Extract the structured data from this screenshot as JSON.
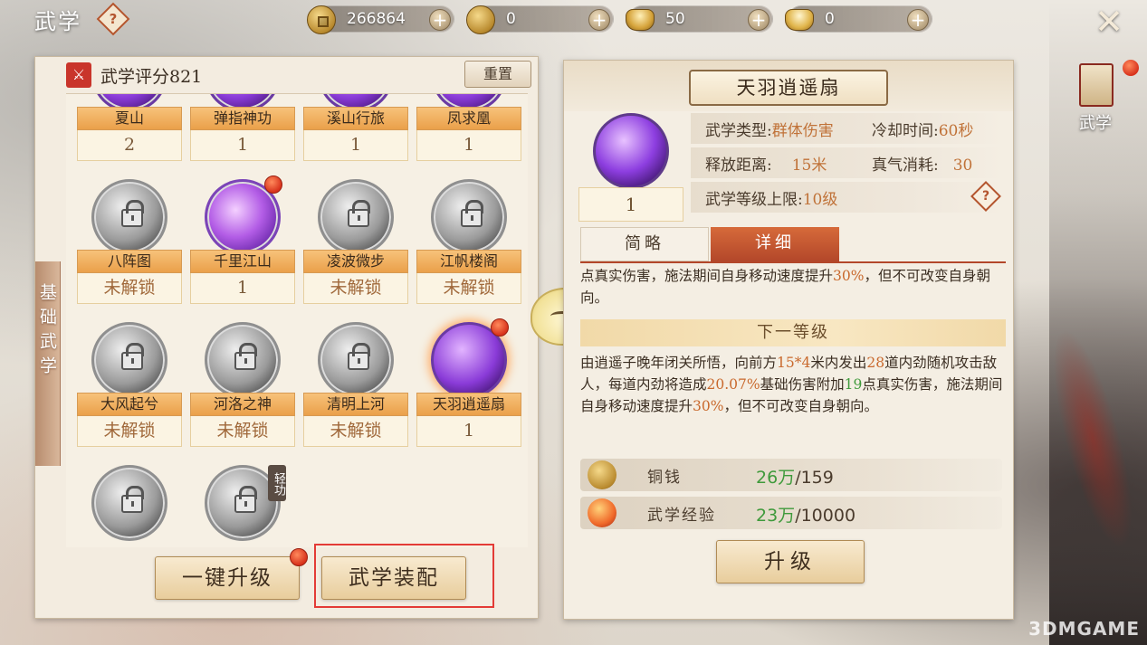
{
  "header": {
    "title": "武学",
    "help_symbol": "?",
    "close_symbol": "✕"
  },
  "currencies": [
    {
      "icon": "copper-coin-icon",
      "value": "266864",
      "plus": "+"
    },
    {
      "icon": "gold-coin-icon",
      "value": "0",
      "plus": "+"
    },
    {
      "icon": "gold-ingot-icon",
      "value": "50",
      "plus": "+"
    },
    {
      "icon": "silver-ingot-icon",
      "value": "0",
      "plus": "+"
    }
  ],
  "left_panel": {
    "side_tab": "基础武学",
    "score_label": "武学评分821",
    "reset_label": "重置",
    "skills": [
      {
        "name": "夏山",
        "value": "2",
        "locked": false
      },
      {
        "name": "弹指神功",
        "value": "1",
        "locked": false
      },
      {
        "name": "溪山行旅",
        "value": "1",
        "locked": false
      },
      {
        "name": "凤求凰",
        "value": "1",
        "locked": false
      },
      {
        "name": "八阵图",
        "value": "未解锁",
        "locked": true
      },
      {
        "name": "千里江山",
        "value": "1",
        "locked": false
      },
      {
        "name": "凌波微步",
        "value": "未解锁",
        "locked": true
      },
      {
        "name": "江帆楼阁",
        "value": "未解锁",
        "locked": true
      },
      {
        "name": "大风起兮",
        "value": "未解锁",
        "locked": true
      },
      {
        "name": "河洛之神",
        "value": "未解锁",
        "locked": true
      },
      {
        "name": "清明上河",
        "value": "未解锁",
        "locked": true
      },
      {
        "name": "天羽逍遥扇",
        "value": "1",
        "locked": false
      }
    ],
    "light_skill_tag": "轻功",
    "one_key_upgrade": "一键升级",
    "equip_label": "武学装配"
  },
  "right_panel": {
    "skill_name": "天羽逍遥扇",
    "level": "1",
    "stats": {
      "type_label": "武学类型:",
      "type_value": "群体伤害",
      "cooldown_label": "冷却时间:",
      "cooldown_value": "60秒",
      "range_label": "释放距离:",
      "range_value": "15米",
      "qi_label": "真气消耗:",
      "qi_value": "30",
      "max_level_label": "武学等级上限:",
      "max_level_value": "10级"
    },
    "tabs": [
      "简略",
      "详细"
    ],
    "desc_current": {
      "a": "点真实伤害，施法期间自身移动速度提升",
      "b": "30%",
      "c": "，但不可改变自身朝向。"
    },
    "next_level_label": "下一等级",
    "desc_next": {
      "p1": "由逍遥子晚年闭关所悟，向前方",
      "p2": "15*4",
      "p3": "米内发出",
      "p4": "28",
      "p5": "道内劲随机攻击敌人，每道内劲将造成",
      "p6": "20.07%",
      "p7": "基础伤害附加",
      "p8": "19",
      "p9": "点真实伤害，施法期间自身移动速度提升",
      "p10": "30%",
      "p11": "，但不可改变自身朝向。"
    },
    "costs": [
      {
        "label": "铜钱",
        "have": "26万",
        "need": "/159"
      },
      {
        "label": "武学经验",
        "have": "23万",
        "need": "/10000"
      }
    ],
    "upgrade_label": "升级"
  },
  "side_nav": {
    "label": "武学"
  },
  "watermark": "3DMGAME"
}
